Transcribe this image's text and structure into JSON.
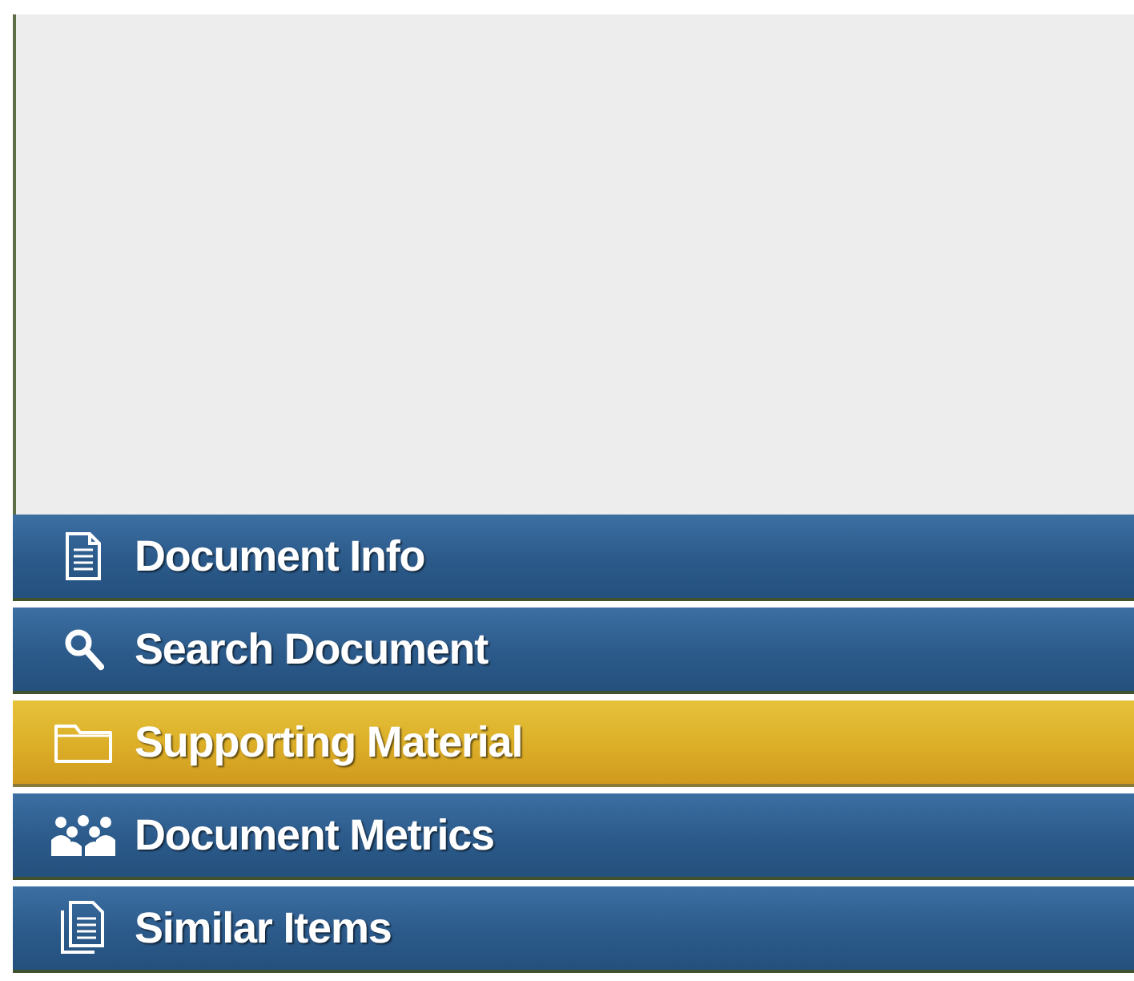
{
  "nav_items": [
    {
      "label": "Document Info",
      "kind": "document",
      "selected": false
    },
    {
      "label": "Search Document",
      "kind": "search",
      "selected": false
    },
    {
      "label": "Supporting Material",
      "kind": "folder",
      "selected": true
    },
    {
      "label": "Document Metrics",
      "kind": "people",
      "selected": false
    },
    {
      "label": "Similar Items",
      "kind": "documents",
      "selected": false
    }
  ]
}
